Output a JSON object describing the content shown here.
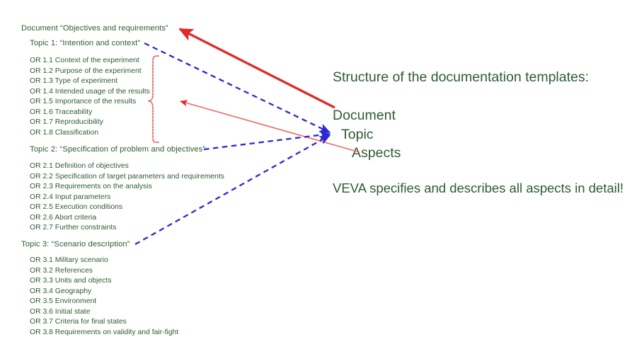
{
  "slide": {
    "background_color": "#ffffff",
    "text_color": "#2e5b33",
    "accent_red": "#e02b2b",
    "accent_blue": "#2a2ad0"
  },
  "outline": {
    "document_title": "Document “Objectives and requirements”",
    "topics": [
      {
        "label": "Topic 1: “Intention and context”",
        "aspects": [
          "OR 1.1 Context of the experiment",
          "OR 1.2 Purpose of the experiment",
          "OR 1.3 Type of experiment",
          "OR 1.4 Intended usage of the results",
          "OR 1.5 Importance of the results",
          "OR 1.6 Traceability",
          "OR 1.7 Reproducibility",
          "OR 1.8 Classification"
        ]
      },
      {
        "label": "Topic 2: “Specification of problem and objectives”",
        "aspects": [
          "OR 2.1 Definition of objectives",
          "OR 2.2 Specification of target parameters and requirements",
          "OR 2.3 Requirements on the analysis",
          "OR 2.4 Input parameters",
          "OR 2.5 Execution conditions",
          "OR 2.6 Abort criteria",
          "OR 2.7 Further constraints"
        ]
      },
      {
        "label": "Topic 3: “Scenario description”",
        "aspects": [
          "OR 3.1 Military scenario",
          "OR 3.2 References",
          "OR 3.3 Units and objects",
          "OR 3.4 Geography",
          "OR 3.5 Environment",
          "OR 3.6 Initial state",
          "OR 3.7 Criteria for final states",
          "OR 3.8 Requirements on validity and fair-fight"
        ]
      }
    ]
  },
  "legend": {
    "heading": "Structure of the documentation templates:",
    "levels": [
      {
        "name": "Document"
      },
      {
        "name": "Topic"
      },
      {
        "name": "Aspects"
      }
    ],
    "conclusion": "VEVA specifies and describes all aspects in detail!"
  }
}
